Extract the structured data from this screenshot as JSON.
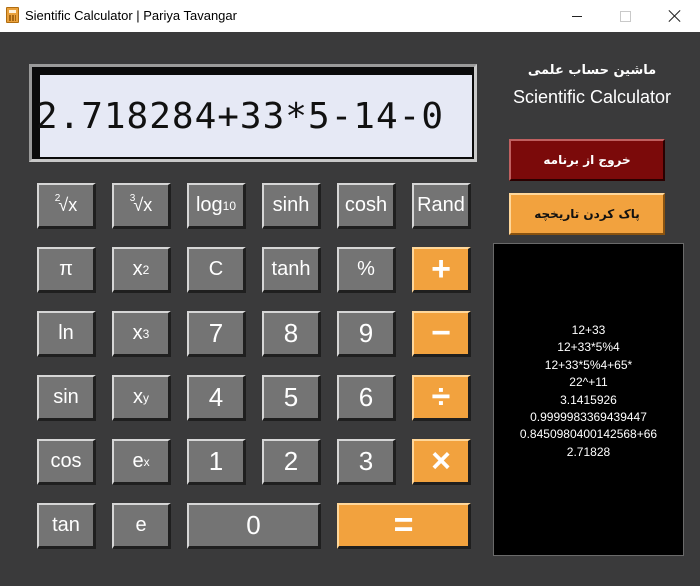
{
  "window": {
    "title": "Sientific Calculator | Pariya Tavangar"
  },
  "display": {
    "value": "2.718284+33*5-14-0"
  },
  "keypad": {
    "sqrt2": "√x",
    "sqrt2_index": "2",
    "sqrt3": "√x",
    "sqrt3_index": "3",
    "log10": "log",
    "log10_sub": "10",
    "sinh": "sinh",
    "cosh": "cosh",
    "rand": "Rand",
    "pi": "π",
    "square": "x",
    "square_sup": "2",
    "clear": "C",
    "tanh": "tanh",
    "percent": "%",
    "plus": "+",
    "ln": "ln",
    "cube": "x",
    "cube_sup": "3",
    "seven": "7",
    "eight": "8",
    "nine": "9",
    "minus": "−",
    "sin": "sin",
    "power": "x",
    "power_sup": "y",
    "four": "4",
    "five": "5",
    "six": "6",
    "divide": "÷",
    "cos": "cos",
    "exp": "e",
    "exp_sup": "x",
    "one": "1",
    "two": "2",
    "three": "3",
    "multiply": "×",
    "tan": "tan",
    "e": "e",
    "zero": "0",
    "equals": "="
  },
  "side_panel": {
    "title_fa": "ماشین حساب علمی",
    "title_en": "Scientific Calculator",
    "exit_label": "خروج از برنامه",
    "clear_history_label": "پاک کردن تاریخچه"
  },
  "history": [
    "12+33",
    "12+33*5%4",
    "12+33*5%4+65*",
    "22^+11",
    "3.1415926",
    "0.9999983369439447",
    "0.8450980400142568+66",
    "2.71828"
  ],
  "colors": {
    "background": "#3a3a3b",
    "key_gray": "#747474",
    "key_orange": "#f2a23e",
    "exit_red": "#7b0a0a",
    "display_bg": "#e6e9f5",
    "history_bg": "#000000"
  }
}
